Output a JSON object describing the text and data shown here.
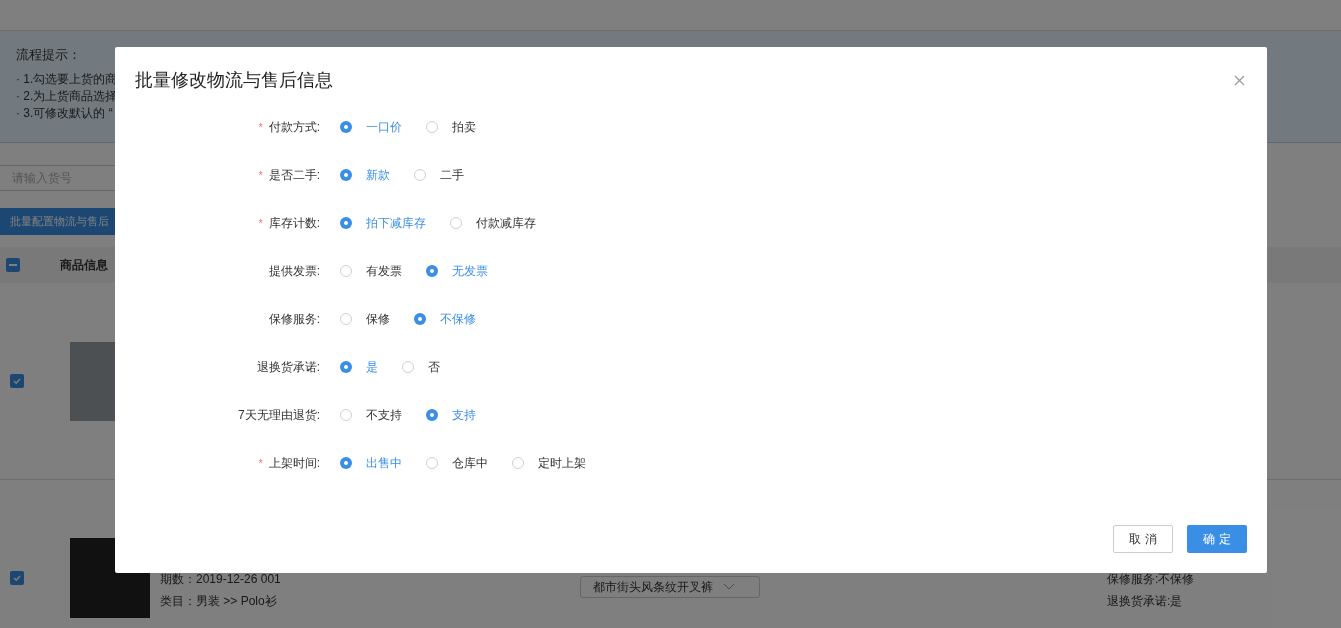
{
  "page": {
    "tips": {
      "title": "流程提示：",
      "lines": [
        "· 1.勾选要上货的商",
        "· 2.为上货商品选择",
        "· 3.可修改默认的 “"
      ]
    },
    "search": {
      "placeholder": "请输入货号"
    },
    "batch_button": "批量配置物流与售后",
    "table": {
      "select_all_indeterminate": true,
      "columns": [
        "商品信息"
      ],
      "rows": [
        {
          "checked": true
        },
        {
          "checked": true,
          "period": "期数：2019-12-26 001",
          "category": "类目：男装 >> Polo衫",
          "style_select": "都市街头风条纹开叉裤",
          "details": [
            "保修服务:不保修",
            "退换货承诺:是"
          ]
        }
      ]
    }
  },
  "dialog": {
    "title": "批量修改物流与售后信息",
    "fields": [
      {
        "label": "付款方式:",
        "required_mark": "*",
        "options": [
          {
            "label": "一口价",
            "selected": true
          },
          {
            "label": "拍卖",
            "selected": false
          }
        ]
      },
      {
        "label": "是否二手:",
        "required_mark": "*",
        "options": [
          {
            "label": "新款",
            "selected": true
          },
          {
            "label": "二手",
            "selected": false
          }
        ]
      },
      {
        "label": "库存计数:",
        "required_mark": "*",
        "options": [
          {
            "label": "拍下减库存",
            "selected": true
          },
          {
            "label": "付款减库存",
            "selected": false
          }
        ]
      },
      {
        "label": "提供发票:",
        "options": [
          {
            "label": "有发票",
            "selected": false
          },
          {
            "label": "无发票",
            "selected": true
          }
        ]
      },
      {
        "label": "保修服务:",
        "options": [
          {
            "label": "保修",
            "selected": false
          },
          {
            "label": "不保修",
            "selected": true
          }
        ]
      },
      {
        "label": "退换货承诺:",
        "options": [
          {
            "label": "是",
            "selected": true
          },
          {
            "label": "否",
            "selected": false
          }
        ]
      },
      {
        "label": "7天无理由退货:",
        "options": [
          {
            "label": "不支持",
            "selected": false
          },
          {
            "label": "支持",
            "selected": true
          }
        ]
      },
      {
        "label": "上架时间:",
        "required_mark": "*",
        "options": [
          {
            "label": "出售中",
            "selected": true
          },
          {
            "label": "仓库中",
            "selected": false
          },
          {
            "label": "定时上架",
            "selected": false
          }
        ]
      }
    ],
    "buttons": [
      {
        "label": "取 消",
        "kind": "secondary"
      },
      {
        "label": "确 定",
        "kind": "primary"
      }
    ]
  }
}
